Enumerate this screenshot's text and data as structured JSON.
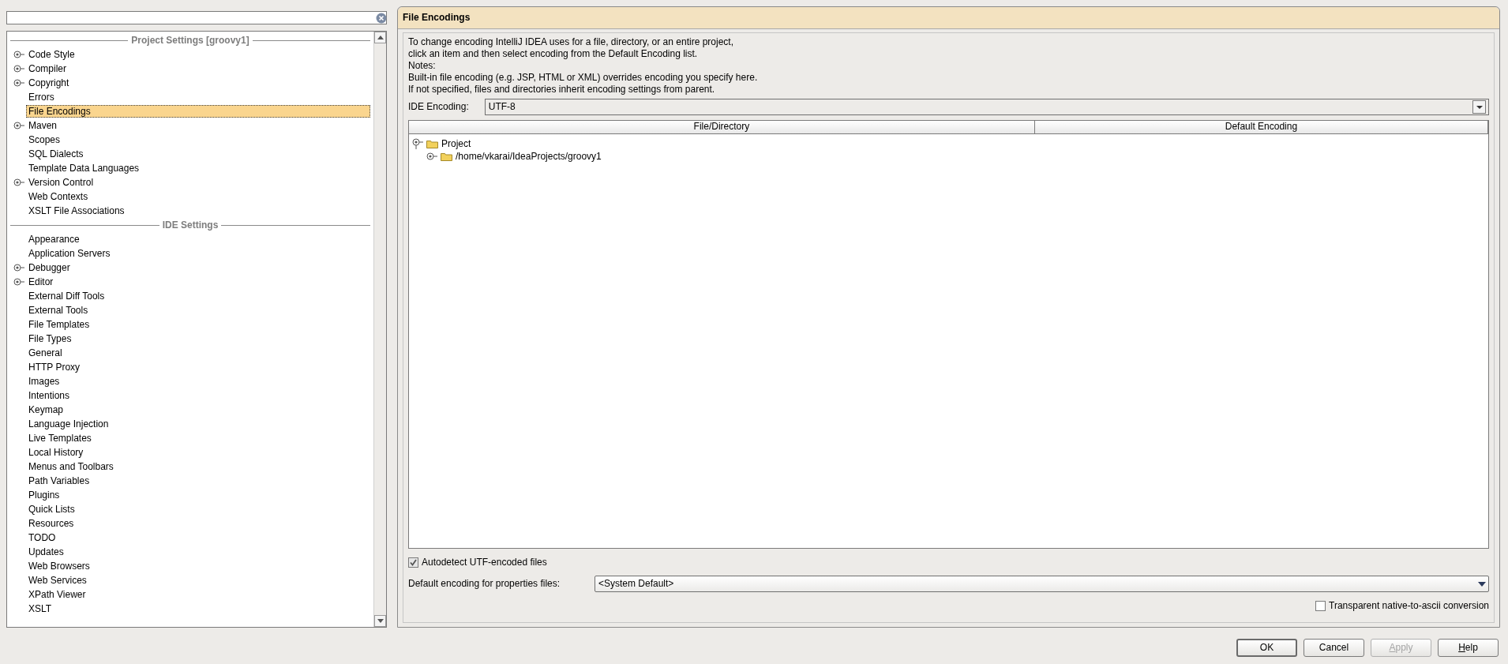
{
  "sidebar": {
    "sections": [
      {
        "title": "Project Settings [groovy1]",
        "items": [
          {
            "label": "Code Style",
            "kind": "group",
            "selected": false
          },
          {
            "label": "Compiler",
            "kind": "group",
            "selected": false
          },
          {
            "label": "Copyright",
            "kind": "group",
            "selected": false
          },
          {
            "label": "Errors",
            "kind": "page",
            "selected": false
          },
          {
            "label": "File Encodings",
            "kind": "page",
            "selected": true
          },
          {
            "label": "Maven",
            "kind": "group",
            "selected": false
          },
          {
            "label": "Scopes",
            "kind": "page",
            "selected": false
          },
          {
            "label": "SQL Dialects",
            "kind": "page",
            "selected": false
          },
          {
            "label": "Template Data Languages",
            "kind": "page",
            "selected": false
          },
          {
            "label": "Version Control",
            "kind": "group",
            "selected": false
          },
          {
            "label": "Web Contexts",
            "kind": "page",
            "selected": false
          },
          {
            "label": "XSLT File Associations",
            "kind": "page",
            "selected": false
          }
        ]
      },
      {
        "title": "IDE Settings",
        "items": [
          {
            "label": "Appearance",
            "kind": "page",
            "selected": false
          },
          {
            "label": "Application Servers",
            "kind": "page",
            "selected": false
          },
          {
            "label": "Debugger",
            "kind": "group",
            "selected": false
          },
          {
            "label": "Editor",
            "kind": "group",
            "selected": false
          },
          {
            "label": "External Diff Tools",
            "kind": "page",
            "selected": false
          },
          {
            "label": "External Tools",
            "kind": "page",
            "selected": false
          },
          {
            "label": "File Templates",
            "kind": "page",
            "selected": false
          },
          {
            "label": "File Types",
            "kind": "page",
            "selected": false
          },
          {
            "label": "General",
            "kind": "page",
            "selected": false
          },
          {
            "label": "HTTP Proxy",
            "kind": "page",
            "selected": false
          },
          {
            "label": "Images",
            "kind": "page",
            "selected": false
          },
          {
            "label": "Intentions",
            "kind": "page",
            "selected": false
          },
          {
            "label": "Keymap",
            "kind": "page",
            "selected": false
          },
          {
            "label": "Language Injection",
            "kind": "page",
            "selected": false
          },
          {
            "label": "Live Templates",
            "kind": "page",
            "selected": false
          },
          {
            "label": "Local History",
            "kind": "page",
            "selected": false
          },
          {
            "label": "Menus and Toolbars",
            "kind": "page",
            "selected": false
          },
          {
            "label": "Path Variables",
            "kind": "page",
            "selected": false
          },
          {
            "label": "Plugins",
            "kind": "page",
            "selected": false
          },
          {
            "label": "Quick Lists",
            "kind": "page",
            "selected": false
          },
          {
            "label": "Resources",
            "kind": "page",
            "selected": false
          },
          {
            "label": "TODO",
            "kind": "page",
            "selected": false
          },
          {
            "label": "Updates",
            "kind": "page",
            "selected": false
          },
          {
            "label": "Web Browsers",
            "kind": "page",
            "selected": false
          },
          {
            "label": "Web Services",
            "kind": "page",
            "selected": false
          },
          {
            "label": "XPath Viewer",
            "kind": "page",
            "selected": false
          },
          {
            "label": "XSLT",
            "kind": "page",
            "selected": false
          }
        ]
      }
    ]
  },
  "content": {
    "title": "File Encodings",
    "description": [
      "To change encoding IntelliJ IDEA uses for a file, directory, or an entire project,",
      "click an item and then select encoding from the Default Encoding list.",
      "Notes:",
      "Built-in file encoding (e.g. JSP, HTML or XML) overrides encoding you specify here.",
      "If not specified, files and directories inherit encoding settings from parent."
    ],
    "ide_encoding": {
      "label": "IDE Encoding:",
      "value": "UTF-8"
    },
    "table": {
      "columns": [
        "File/Directory",
        "Default Encoding"
      ],
      "rows": [
        {
          "label": "Project",
          "expanded": true,
          "children": [
            {
              "label": "/home/vkarai/IdeaProjects/groovy1",
              "expanded": false
            }
          ]
        }
      ]
    },
    "autodetect": {
      "label": "Autodetect UTF-encoded files",
      "checked": true
    },
    "properties_encoding": {
      "label": "Default encoding for properties files:",
      "value": "<System Default>"
    },
    "native_to_ascii": {
      "label": "Transparent native-to-ascii conversion",
      "checked": false
    }
  },
  "buttons": [
    {
      "label": "OK",
      "default": true,
      "disabled": false,
      "mnemonic": false
    },
    {
      "label": "Cancel",
      "default": false,
      "disabled": false,
      "mnemonic": false
    },
    {
      "label": "Apply",
      "default": false,
      "disabled": true,
      "mnemonic": true
    },
    {
      "label": "Help",
      "default": false,
      "disabled": false,
      "mnemonic": true
    }
  ]
}
